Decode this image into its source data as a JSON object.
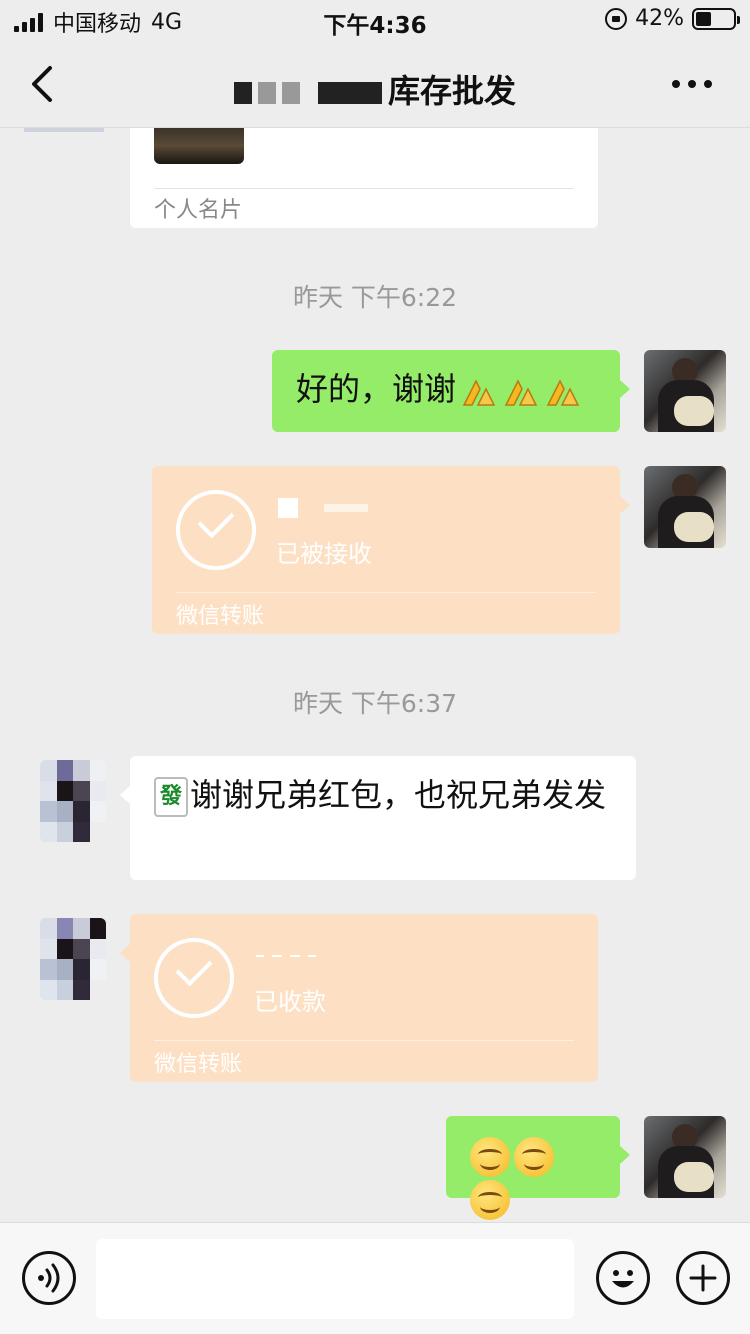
{
  "status_bar": {
    "carrier": "中国移动",
    "network": "4G",
    "time": "下午4:36",
    "battery": "42%",
    "battery_level": 0.42
  },
  "header": {
    "title_visible": "库存批发"
  },
  "icons": {
    "back": "chevron-left-icon",
    "more": "more-dots-icon",
    "voice": "voice-icon",
    "emoji": "emoji-icon",
    "plus": "plus-icon"
  },
  "messages": {
    "card_label": "个人名片",
    "timestamp_1": "昨天 下午6:22",
    "msg_1_text": "好的，谢谢",
    "transfer_1_status": "已被接收",
    "transfer_1_footer": "微信转账",
    "timestamp_2": "昨天 下午6:37",
    "msg_2_tile": "發",
    "msg_2_text": "谢谢兄弟红包，也祝兄弟发发",
    "transfer_2_status": "已收款",
    "transfer_2_footer": "微信转账"
  },
  "colors": {
    "bubble_green": "#95ec69",
    "transfer_orange": "#fde0c4",
    "background": "#ededed"
  }
}
